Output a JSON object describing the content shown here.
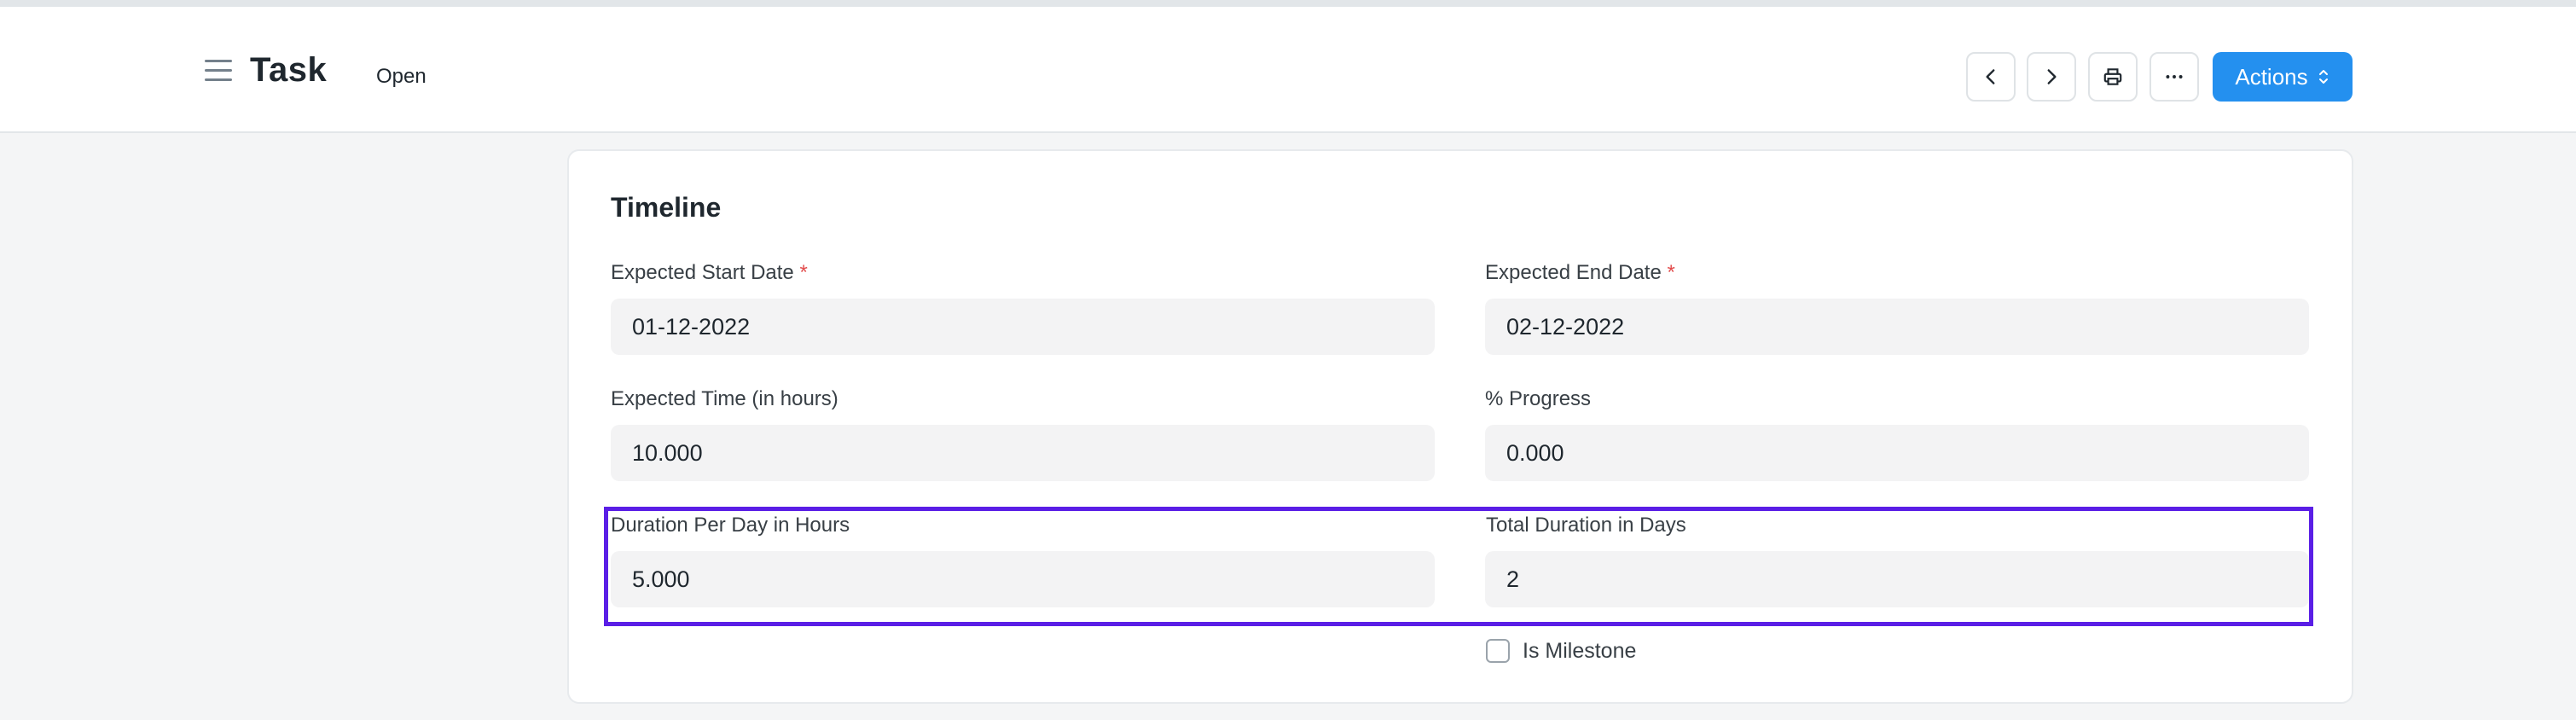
{
  "header": {
    "title": "Task",
    "status": "Open",
    "actions_label": "Actions"
  },
  "section": {
    "title": "Timeline"
  },
  "fields": {
    "expected_start_date": {
      "label": "Expected Start Date",
      "required": "*",
      "value": "01-12-2022"
    },
    "expected_end_date": {
      "label": "Expected End Date",
      "required": "*",
      "value": "02-12-2022"
    },
    "expected_time": {
      "label": "Expected Time (in hours)",
      "value": "10.000"
    },
    "progress": {
      "label": "% Progress",
      "value": "0.000"
    },
    "duration_per_day": {
      "label": "Duration Per Day in Hours",
      "value": "5.000"
    },
    "total_duration": {
      "label": "Total Duration in Days",
      "value": "2"
    }
  },
  "milestone": {
    "label": "Is Milestone",
    "checked": false
  },
  "icons": [
    "menu-icon",
    "chevron-left-icon",
    "chevron-right-icon",
    "printer-icon",
    "more-icon",
    "sort-icon"
  ],
  "colors": {
    "primary": "#2490ef",
    "highlight": "#5a1ee6",
    "required": "#e24c4c"
  }
}
